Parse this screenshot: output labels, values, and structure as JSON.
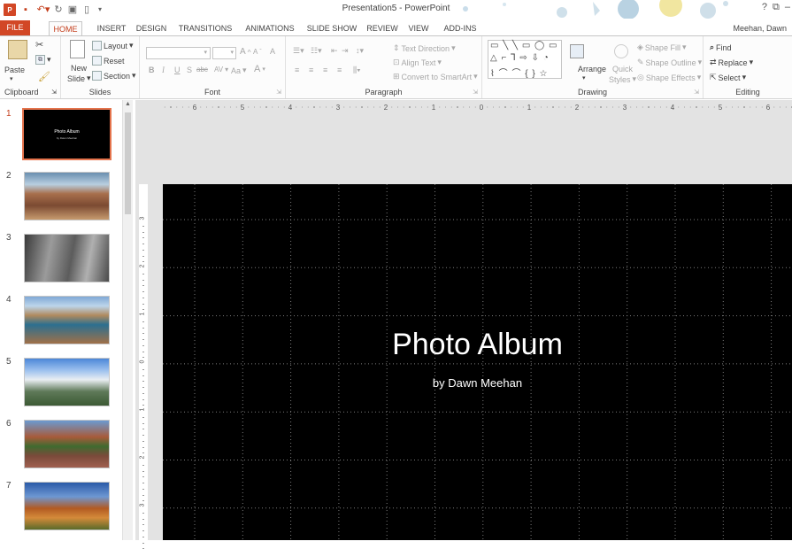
{
  "window": {
    "title": "Presentation5 - PowerPoint",
    "user": "Meehan, Dawn",
    "app_badge": "P",
    "controls": [
      "?",
      "⧉",
      "–",
      "□"
    ]
  },
  "tabs": [
    "FILE",
    "HOME",
    "INSERT",
    "DESIGN",
    "TRANSITIONS",
    "ANIMATIONS",
    "SLIDE SHOW",
    "REVIEW",
    "VIEW",
    "ADD-INS"
  ],
  "ribbon": {
    "clipboard": {
      "label": "Clipboard",
      "paste": "Paste"
    },
    "slides": {
      "label": "Slides",
      "new_slide": "New",
      "new_slide2": "Slide",
      "layout": "Layout",
      "reset": "Reset",
      "section": "Section"
    },
    "font": {
      "label": "Font",
      "bold": "B",
      "italic": "I",
      "underline": "U",
      "shadow": "S",
      "strike": "abc",
      "spacing": "AV",
      "case": "Aa",
      "grow": "A",
      "shrink": "A",
      "clear": "A"
    },
    "paragraph": {
      "label": "Paragraph",
      "text_direction": "Text Direction",
      "align_text": "Align Text",
      "smartart": "Convert to SmartArt"
    },
    "drawing": {
      "label": "Drawing",
      "arrange": "Arrange",
      "quick_styles": "Quick",
      "quick_styles2": "Styles",
      "fill": "Shape Fill",
      "outline": "Shape Outline",
      "effects": "Shape Effects",
      "shapes_row1": "▭ ╲ ╲ ▭ ◯ ▭",
      "shapes_row2": "△ ⌐ ⅂ ⇨ ⇩ ◔",
      "shapes_row3": "⌇ ⌒ ⌒ { } ☆"
    },
    "editing": {
      "label": "Editing",
      "find": "Find",
      "replace": "Replace",
      "select": "Select"
    }
  },
  "ruler": {
    "h": [
      "6",
      "5",
      "4",
      "3",
      "2",
      "1",
      "0",
      "1",
      "2",
      "3",
      "4",
      "5",
      "6"
    ],
    "v": [
      "3",
      "2",
      "1",
      "0",
      "1",
      "2",
      "3"
    ]
  },
  "slides": [
    {
      "num": "1",
      "thumb_title": "Photo Album",
      "thumb_sub": "by Dawn Meehan"
    },
    {
      "num": "2"
    },
    {
      "num": "3"
    },
    {
      "num": "4"
    },
    {
      "num": "5"
    },
    {
      "num": "6"
    },
    {
      "num": "7"
    }
  ],
  "slide": {
    "title": "Photo Album",
    "subtitle": "by Dawn Meehan"
  },
  "colors": {
    "accent": "#d24726",
    "selected_tab_text": "#c43e1c",
    "slide_bg": "#000000",
    "thumb_select": "#e5744d"
  }
}
